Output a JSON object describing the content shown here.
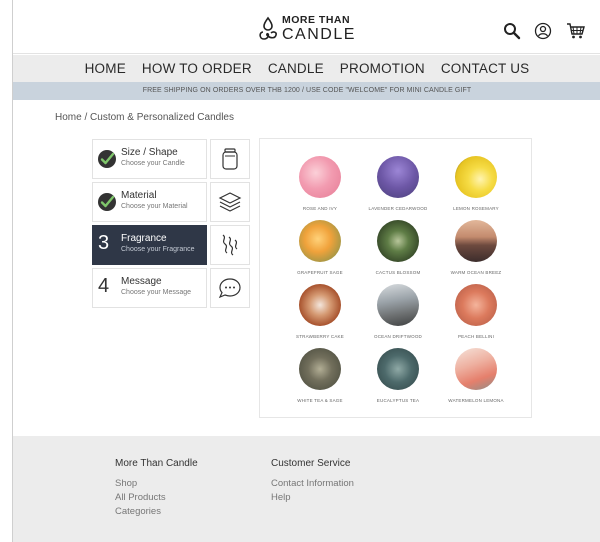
{
  "header": {
    "logo_top": "MORE THAN",
    "logo_bottom": "CANDLE",
    "icons": [
      "search-icon",
      "account-icon",
      "cart-icon"
    ]
  },
  "nav": {
    "items": [
      "HOME",
      "HOW TO ORDER",
      "CANDLE",
      "PROMOTION",
      "CONTACT US"
    ]
  },
  "promo": {
    "text": "FREE SHIPPING ON ORDERS OVER THB 1200 / USE CODE \"WELCOME\" FOR MINI CANDLE GIFT"
  },
  "breadcrumb": {
    "home": "Home",
    "sep": "/",
    "current": "Custom & Personalized Candles"
  },
  "steps": [
    {
      "title": "Size / Shape",
      "sub": "Choose your Candle",
      "state": "done",
      "icon": "jar-icon"
    },
    {
      "title": "Material",
      "sub": "Choose your Material",
      "state": "done",
      "icon": "layers-icon"
    },
    {
      "number": "3",
      "title": "Fragrance",
      "sub": "Choose your Fragrance",
      "state": "active",
      "icon": "scent-icon"
    },
    {
      "number": "4",
      "title": "Message",
      "sub": "Choose your Message",
      "state": "todo",
      "icon": "chat-icon"
    }
  ],
  "fragrances": [
    {
      "label": "ROSE AND IVY",
      "color": "#f2a6b5"
    },
    {
      "label": "LAVENDER CEDARWOOD",
      "color": "#6e5aa8"
    },
    {
      "label": "LEMON ROSEMARY",
      "color": "#f1d13c"
    },
    {
      "label": "GRAPEFRUIT SAGE",
      "color": "#f0a23b"
    },
    {
      "label": "CACTUS BLOSSOM",
      "color": "#4d6b3c"
    },
    {
      "label": "WARM OCEAN BREEZ",
      "color": "#9a6a55"
    },
    {
      "label": "STRAWBERRY CAKE",
      "color": "#b8643e"
    },
    {
      "label": "OCEAN DRIFTWOOD",
      "color": "#8a8f96"
    },
    {
      "label": "PEACH BELLINI",
      "color": "#d9735e"
    },
    {
      "label": "WHITE TEA & SAGE",
      "color": "#5f6650"
    },
    {
      "label": "EUCALYPTUS TEA",
      "color": "#3f5a5c"
    },
    {
      "label": "WATERMELON LEMONA",
      "color": "#e79a88"
    }
  ],
  "footer": {
    "col1": {
      "heading": "More Than Candle",
      "links": [
        "Shop",
        "All Products",
        "Categories"
      ]
    },
    "col2": {
      "heading": "Customer Service",
      "links": [
        "Contact Information",
        "Help"
      ]
    }
  }
}
